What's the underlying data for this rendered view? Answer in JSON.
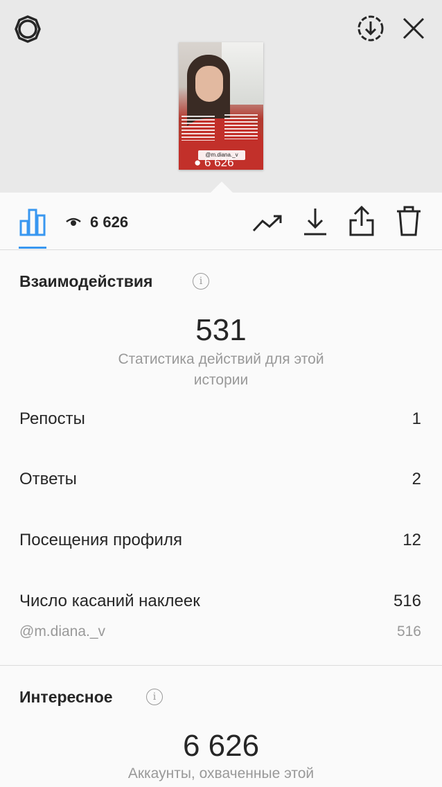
{
  "header": {
    "icons": {
      "settings": "settings-gear-icon",
      "download": "download-circle-icon",
      "close": "close-icon"
    }
  },
  "story": {
    "thumbnail_sticker": "@m.diana._v",
    "thumbnail_views": "6 626"
  },
  "toolbar": {
    "views": "6 626",
    "icons": [
      "bar-chart-icon",
      "eye-icon",
      "trending-icon",
      "save-icon",
      "share-icon",
      "trash-icon"
    ],
    "active_tab_color": "#3897f0"
  },
  "interactions": {
    "title": "Взаимодействия",
    "total": "531",
    "total_caption": "Статистика действий для этой истории",
    "rows": [
      {
        "label": "Репосты",
        "value": "1"
      },
      {
        "label": "Ответы",
        "value": "2"
      },
      {
        "label": "Посещения профиля",
        "value": "12"
      },
      {
        "label": "Число касаний наклеек",
        "value": "516"
      }
    ],
    "sticker_row": {
      "label": "@m.diana._v",
      "value": "516"
    }
  },
  "discovery": {
    "title": "Интересное",
    "total": "6 626",
    "total_caption": "Аккаунты, охваченные этой"
  }
}
